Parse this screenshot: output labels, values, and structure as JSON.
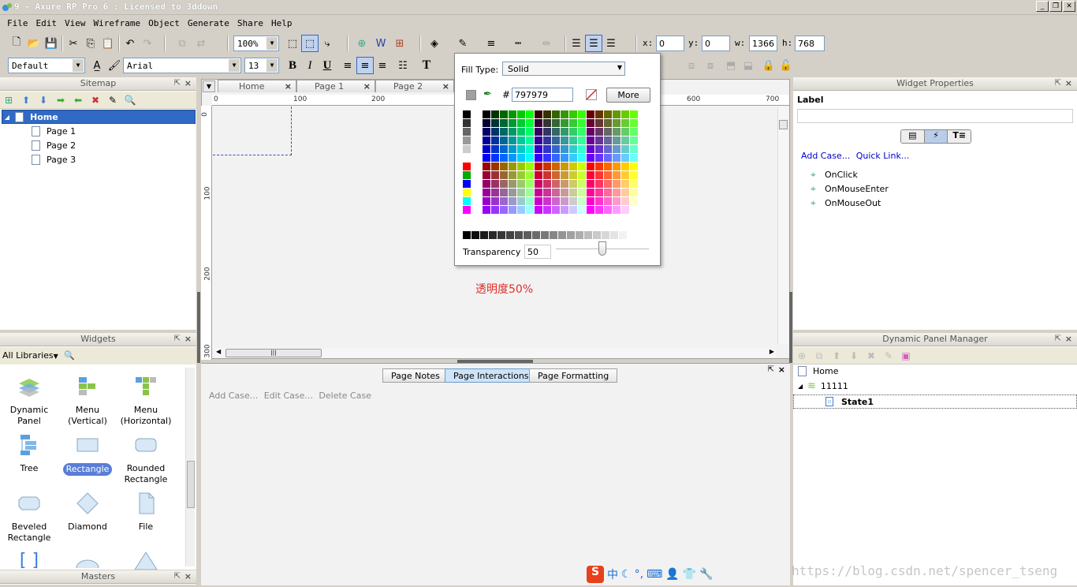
{
  "window": {
    "title": "9 - Axure RP Pro 6 : Licensed to 3ddown"
  },
  "menu": [
    "File",
    "Edit",
    "View",
    "Wireframe",
    "Object",
    "Generate",
    "Share",
    "Help"
  ],
  "toolbar1": {
    "zoom": "100%",
    "x_label": "x:",
    "x_value": "0",
    "y_label": "y:",
    "y_value": "0",
    "w_label": "w:",
    "w_value": "1366",
    "h_label": "h:",
    "h_value": "768"
  },
  "toolbar2": {
    "style": "Default",
    "font": "Arial",
    "size": "13",
    "bold": "B",
    "italic": "I",
    "underline": "U",
    "text_tool": "T"
  },
  "sitemap": {
    "title": "Sitemap",
    "home": "Home",
    "pages": [
      "Page 1",
      "Page 2",
      "Page 3"
    ]
  },
  "widgets": {
    "title": "Widgets",
    "library": "All Libraries",
    "items": [
      {
        "label": "Dynamic Panel",
        "icon": "dynamic-panel-icon"
      },
      {
        "label": "Menu\n(Vertical)",
        "icon": "menu-vertical-icon"
      },
      {
        "label": "Menu\n(Horizontal)",
        "icon": "menu-horizontal-icon"
      },
      {
        "label": "Tree",
        "icon": "tree-icon"
      },
      {
        "label": "Rectangle",
        "icon": "rectangle-icon"
      },
      {
        "label": "Rounded\nRectangle",
        "icon": "rounded-rectangle-icon"
      },
      {
        "label": "Beveled\nRectangle",
        "icon": "beveled-rectangle-icon"
      },
      {
        "label": "Diamond",
        "icon": "diamond-icon"
      },
      {
        "label": "File",
        "icon": "file-icon"
      }
    ]
  },
  "masters": {
    "title": "Masters"
  },
  "canvas": {
    "tabs": [
      "Home",
      "Page 1",
      "Page 2"
    ],
    "ruler_h": [
      "0",
      "100",
      "200",
      "600",
      "700"
    ],
    "ruler_v": [
      "0",
      "100",
      "200",
      "300"
    ],
    "annotation": "透明度50%"
  },
  "fill_popup": {
    "fill_type_label": "Fill Type:",
    "fill_type": "Solid",
    "hash": "#",
    "hex": "797979",
    "more": "More",
    "transparency_label": "Transparency",
    "transparency": "50",
    "transparency_level": 0.5
  },
  "bottom_panel": {
    "tabs": [
      "Page Notes",
      "Page Interactions",
      "Page Formatting"
    ],
    "selected_tab": "Page Interactions",
    "actions": [
      "Add Case...",
      "Edit Case...",
      "Delete Case"
    ]
  },
  "widget_properties": {
    "title": "Widget Properties",
    "label_heading": "Label",
    "label_value": "",
    "add_case": "Add Case...",
    "quick_link": "Quick Link...",
    "events": [
      "OnClick",
      "OnMouseEnter",
      "OnMouseOut"
    ]
  },
  "dynamic_panel_manager": {
    "title": "Dynamic Panel Manager",
    "root": "Home",
    "panel": "11111",
    "state": "State1"
  },
  "watermark": "https://blog.csdn.net/spencer_tseng",
  "colors": {
    "selection": "#316ac5",
    "link_blue": "#0000cc",
    "annotation_red": "#e0302a"
  }
}
